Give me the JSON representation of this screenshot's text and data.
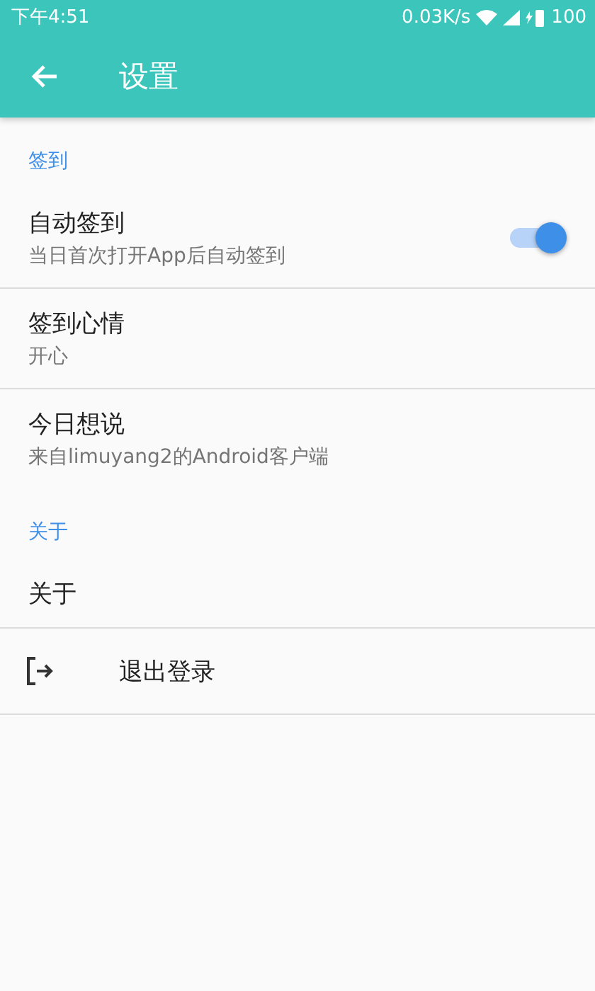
{
  "status_bar": {
    "time": "下午4:51",
    "speed": "0.03K/s",
    "battery": "100"
  },
  "toolbar": {
    "title": "设置"
  },
  "sections": [
    {
      "header": "签到",
      "items": [
        {
          "kind": "switch",
          "title": "自动签到",
          "summary": "当日首次打开App后自动签到",
          "on": true
        },
        {
          "kind": "text",
          "title": "签到心情",
          "summary": "开心"
        },
        {
          "kind": "text",
          "title": "今日想说",
          "summary": "来自limuyang2的Android客户端"
        }
      ]
    },
    {
      "header": "关于",
      "items": [
        {
          "kind": "text",
          "title": "关于"
        }
      ]
    }
  ],
  "logout": {
    "label": "退出登录"
  }
}
